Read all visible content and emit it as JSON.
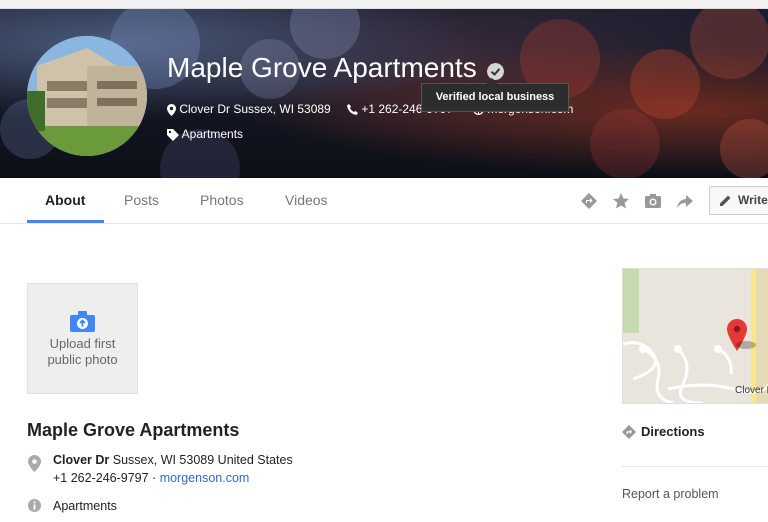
{
  "header": {
    "title": "Maple Grove Apartments",
    "tooltip": "Verified local business",
    "address": "Clover Dr Sussex, WI 53089",
    "phone": "+1 262-246-9797",
    "website": "morgenson.com",
    "category": "Apartments"
  },
  "tabs": [
    {
      "label": "About",
      "active": true
    },
    {
      "label": "Posts"
    },
    {
      "label": "Photos"
    },
    {
      "label": "Videos"
    }
  ],
  "actions": {
    "write_label": "Write"
  },
  "left": {
    "upload_label_1": "Upload first",
    "upload_label_2": "public photo",
    "business_name": "Maple Grove Apartments",
    "address_street": "Clover Dr",
    "address_rest": " Sussex, WI 53089 United States",
    "phone": "+1 262-246-9797",
    "separator": " · ",
    "website": "morgenson.com",
    "category": "Apartments"
  },
  "right": {
    "map_label": "Clover D",
    "directions": "Directions",
    "report": "Report a problem"
  },
  "colors": {
    "accent": "#4285f4",
    "link": "#3366cc"
  }
}
